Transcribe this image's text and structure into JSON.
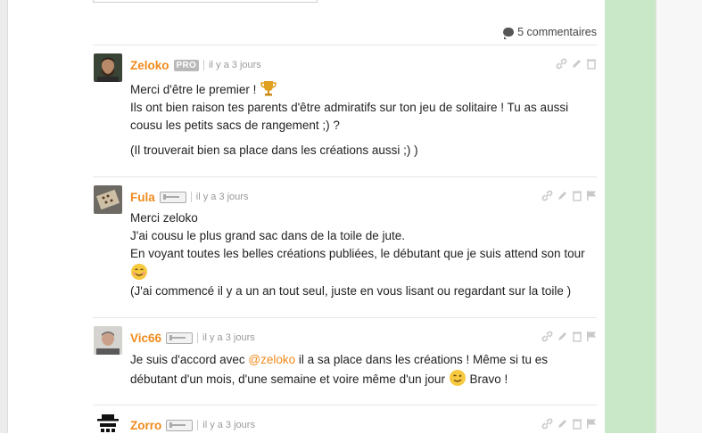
{
  "comments_count": "5 commentaires",
  "comments": [
    {
      "user": "Zeloko",
      "badge": "PRO",
      "time": "il y a 3 jours",
      "lines": {
        "l1": "Merci d'être le premier !",
        "l2": "Ils ont bien raison tes parents d'être admiratifs sur ton jeu de solitaire ! Tu as aussi cousu les petits sacs de rangement ;) ?",
        "l3": "(Il trouverait bien sa place dans les créations aussi ;) )"
      }
    },
    {
      "user": "Fula",
      "time": "il y a 3 jours",
      "lines": {
        "l1": "Merci zeloko",
        "l2": "J'ai cousu le plus grand sac dans de la toile de jute.",
        "l3": "En voyant toutes les belles créations publiées, le débutant que je suis attend son tour",
        "l4": "(J'ai commencé il y a un an tout seul, juste en vous lisant ou regardant sur la toile )"
      }
    },
    {
      "user": "Vic66",
      "time": "il y a 3 jours",
      "lines": {
        "l1a": "Je suis d'accord avec ",
        "mention": "@zeloko",
        "l1b": " il a sa place dans les créations ! Même si tu es débutant d'un mois, d'une semaine et voire même d'un jour ",
        "l1c": " Bravo !"
      }
    },
    {
      "user": "Zorro",
      "time": "il y a 3 jours"
    }
  ]
}
